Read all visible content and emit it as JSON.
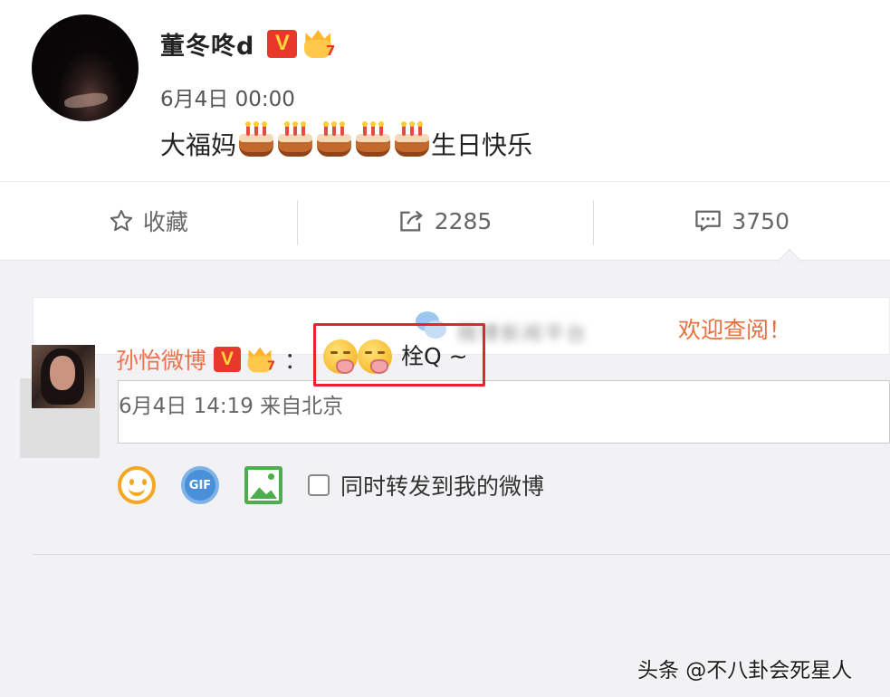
{
  "post": {
    "author": "董冬咚d",
    "v_badge": "V",
    "crown_level": "7",
    "time": "6月4日 00:00",
    "text_prefix": "大福妈",
    "cake_emoji_count": 5,
    "text_suffix": "生日快乐"
  },
  "actions": {
    "favorite_label": "收藏",
    "repost_count": "2285",
    "comment_count": "3750"
  },
  "notice": {
    "blurred_text": "微博新闻平台",
    "link_text": "欢迎查阅！"
  },
  "composer": {
    "input_value": "",
    "repost_label": "同时转发到我的微博",
    "gif_label": "GIF"
  },
  "reply": {
    "author": "孙怡微博",
    "v_badge": "V",
    "crown_level": "7",
    "colon": "：",
    "text": "栓Q ~",
    "meta": "6月4日 14:19 来自北京"
  },
  "watermark": "头条 @不八卦会死星人",
  "colors": {
    "accent_orange": "#eb7350",
    "highlight_red": "#e8232b",
    "background": "#f2f2f5"
  }
}
